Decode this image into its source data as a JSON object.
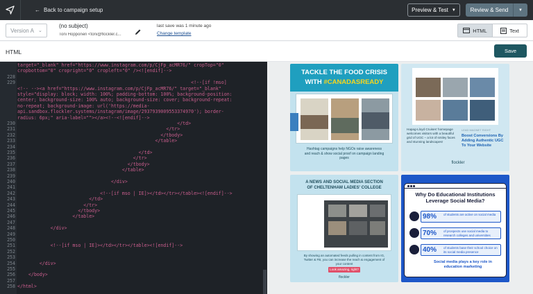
{
  "top": {
    "back": "Back to campaign setup",
    "preview_test": "Preview & Test",
    "review_send": "Review & Send"
  },
  "sub": {
    "version": "Version A",
    "subject": "(no subject)",
    "sender": "Toni Hopponen <toni@flockler.c...",
    "last_save": "last save was 1 minute ago",
    "change_template": "Change template",
    "html_btn": "HTML",
    "text_btn": "Text"
  },
  "bar3": {
    "title": "HTML",
    "save": "Save"
  },
  "code": {
    "lines": [
      {
        "n": "",
        "t": "target=\"_blank\" href=\"https://www.instagram.com/p/CjFp_acMR76/\" cropTop=\"0\""
      },
      {
        "n": "",
        "t": "cropbottom=\"0\" cropright=\"0\" cropleft=\"0\" /><![endif]-->"
      },
      {
        "n": "228",
        "t": ""
      },
      {
        "n": "229",
        "t": "                                                               <!--[if !mso]"
      },
      {
        "n": "",
        "t": "<!-- --><a href=\"https://www.instagram.com/p/CjFp_acMR76/\" target=\"_blank\""
      },
      {
        "n": "",
        "t": "style=\"display: block; width: 100%; padding-bottom: 100%; background-position:"
      },
      {
        "n": "",
        "t": "center; background-size: 100% auto; background-size: cover; background-repeat:"
      },
      {
        "n": "",
        "t": "no-repeat; background-image: url('https://media-"
      },
      {
        "n": "",
        "t": "api.sandbox.flockler.systems/instagram/image/2937939009553374970'); border-"
      },
      {
        "n": "",
        "t": "radius: 6px;\" aria-label=\"\"></a><!--<![endif]-->"
      },
      {
        "n": "230",
        "t": "                                                          </td>"
      },
      {
        "n": "231",
        "t": "                                                      </tr>"
      },
      {
        "n": "232",
        "t": "                                                    </tbody>"
      },
      {
        "n": "233",
        "t": "                                                  </table>"
      },
      {
        "n": "234",
        "t": ""
      },
      {
        "n": "235",
        "t": "                                            </td>"
      },
      {
        "n": "236",
        "t": "                                          </tr>"
      },
      {
        "n": "237",
        "t": "                                        </tbody>"
      },
      {
        "n": "238",
        "t": "                                      </table>"
      },
      {
        "n": "239",
        "t": ""
      },
      {
        "n": "240",
        "t": "                                  </div>"
      },
      {
        "n": "241",
        "t": ""
      },
      {
        "n": "242",
        "t": "                              <!--[if mso | IE]></td></tr></table><![endif]-->"
      },
      {
        "n": "243",
        "t": "                          </td>"
      },
      {
        "n": "244",
        "t": "                        </tr>"
      },
      {
        "n": "245",
        "t": "                      </tbody>"
      },
      {
        "n": "246",
        "t": "                    </table>"
      },
      {
        "n": "247",
        "t": ""
      },
      {
        "n": "248",
        "t": "            </div>"
      },
      {
        "n": "249",
        "t": ""
      },
      {
        "n": "250",
        "t": ""
      },
      {
        "n": "251",
        "t": "            <!--[if mso | IE]></td></tr></table><![endif]-->"
      },
      {
        "n": "252",
        "t": ""
      },
      {
        "n": "253",
        "t": ""
      },
      {
        "n": "254",
        "t": "        </div>"
      },
      {
        "n": "255",
        "t": ""
      },
      {
        "n": "256",
        "t": "    </body>"
      },
      {
        "n": "257",
        "t": ""
      },
      {
        "n": "258",
        "t": "</html>"
      }
    ]
  },
  "preview": {
    "card1": {
      "title_line1": "TACKLE THE FOOD CRISIS",
      "title_line2": "WITH",
      "hashtag": "#CANADASREADY",
      "caption": "Hashtag campaigns help NGOs raise awareness and reach & show social proof on campaign landing pages"
    },
    "card2": {
      "caption": "Hapag-Lloyd Cruises' homepage welcomes visitors with a beautiful grid of UGC – a lot of smiley faces and stunning landscapes!",
      "lead": "LEAD MAGNET RIGHT",
      "headline": "Boost Conversions By Adding Authentic UGC To Your Website",
      "brand": "flockler"
    },
    "card3": {
      "title_line1": "A NEWS AND SOCIAL MEDIA SECTION",
      "title_line2": "OF",
      "title_brand": "CHELTENHAM LADIES' COLLEGE",
      "caption": "By showing an automated feeds pulling in content from IG, Twitter & FB, you can increase the reach & engagement of your content",
      "cta": "Look amazing, right?",
      "brand": "flockler"
    },
    "card4": {
      "title": "Why Do Educational Institutions Leverage Social Media?",
      "stats": [
        {
          "pct": "98%",
          "text": "of students are active on social media"
        },
        {
          "pct": "70%",
          "text": "of prospects use social media to research colleges and universities"
        },
        {
          "pct": "40%",
          "text": "of students base their school choice on its social media presence"
        }
      ],
      "footer": "Social media plays a key role in education marketing"
    }
  },
  "colors": {
    "topbar": "#2b2f33",
    "teal": "#1e5761",
    "code_pink": "#c85d8c",
    "blue_card": "#1d57c8",
    "light_blue": "#c3e2ee"
  }
}
